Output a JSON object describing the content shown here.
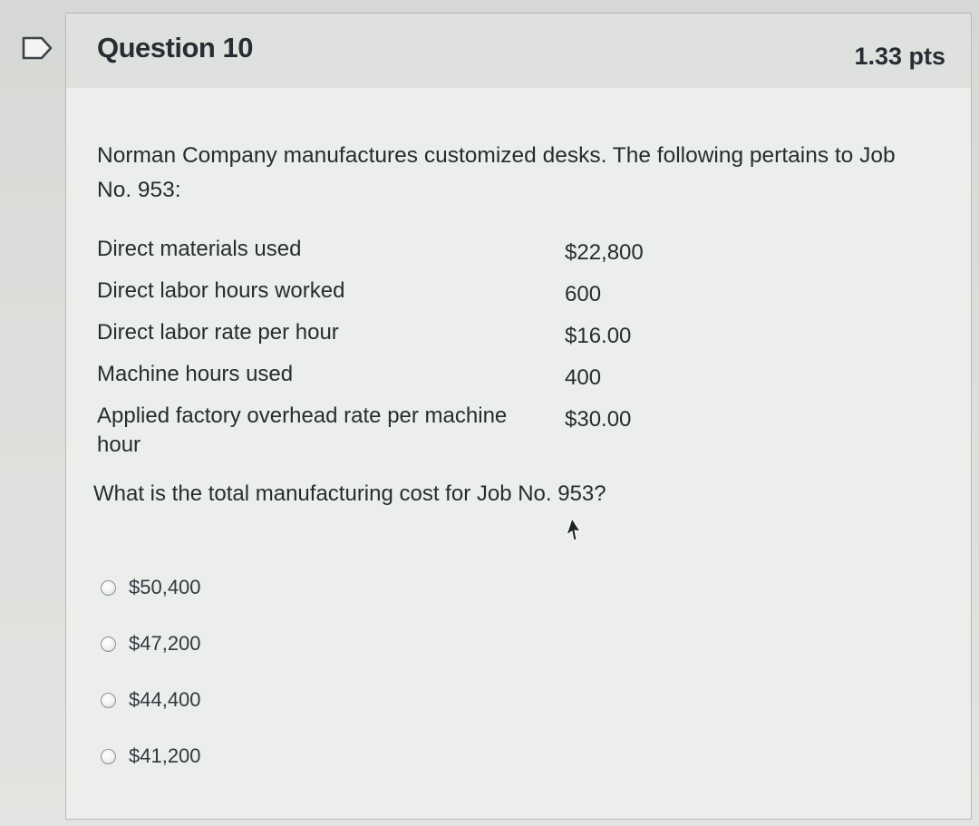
{
  "question": {
    "title": "Question 10",
    "points": "1.33 pts",
    "intro": "Norman Company manufactures customized desks. The following pertains to Job No. 953:",
    "data_rows": [
      {
        "label": "Direct materials used",
        "value": "$22,800"
      },
      {
        "label": "Direct labor hours worked",
        "value": "600"
      },
      {
        "label": "Direct labor rate per hour",
        "value": "$16.00"
      },
      {
        "label": "Machine hours used",
        "value": "400"
      },
      {
        "label": "Applied factory overhead rate per machine hour",
        "value": "$30.00"
      }
    ],
    "prompt": "What is the total manufacturing cost for Job No. 953?",
    "answers": [
      {
        "label": "$50,400",
        "selected": false
      },
      {
        "label": "$47,200",
        "selected": false
      },
      {
        "label": "$44,400",
        "selected": false
      },
      {
        "label": "$41,200",
        "selected": false
      }
    ]
  },
  "icons": {
    "flag": "flag-bookmark-icon",
    "cursor": "mouse-pointer-icon"
  },
  "colors": {
    "text": "#252d31",
    "header_bg": "#dfe1de",
    "body_bg": "#eceeeb",
    "border": "#b3b5b2"
  }
}
